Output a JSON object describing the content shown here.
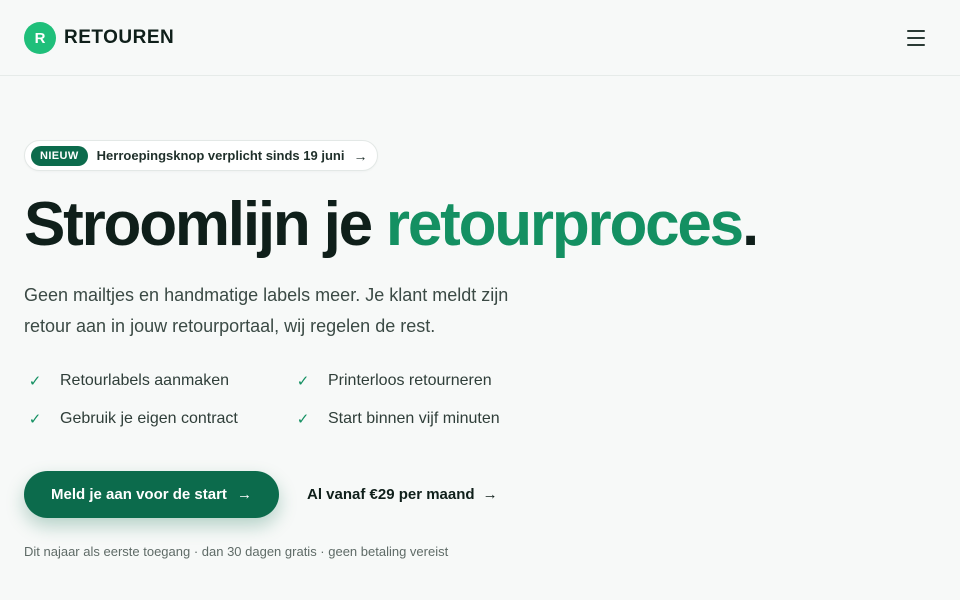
{
  "brand": {
    "logo_letter": "R",
    "name": "RETOUREN",
    "accent_color": "#149062",
    "logo_color": "#1fbf7a",
    "button_color": "#0c6b4c"
  },
  "nav": {
    "menu_icon": "hamburger-menu-icon"
  },
  "announcement": {
    "badge": "NIEUW",
    "text": "Herroepingsknop verplicht sinds 19 juni",
    "arrow": "→"
  },
  "hero": {
    "headline_main": "Stroomlijn je ",
    "headline_accent": "retourproces",
    "headline_end": ".",
    "subtitle": "Geen mailtjes en handmatige labels meer. Je klant meldt zijn retour aan in jouw retourportaal, wij regelen de rest."
  },
  "features": [
    {
      "label": "Retourlabels aanmaken",
      "icon": "check-icon"
    },
    {
      "label": "Printerloos retourneren",
      "icon": "check-icon"
    },
    {
      "label": "Gebruik je eigen contract",
      "icon": "check-icon"
    },
    {
      "label": "Start binnen vijf minuten",
      "icon": "check-icon"
    }
  ],
  "cta": {
    "primary_label": "Meld je aan voor de start",
    "primary_arrow": "→",
    "secondary_label": "Al vanaf €29 per maand",
    "secondary_arrow": "→"
  },
  "footnote": "Dit najaar als eerste toegang · dan 30 dagen gratis · geen betaling vereist"
}
